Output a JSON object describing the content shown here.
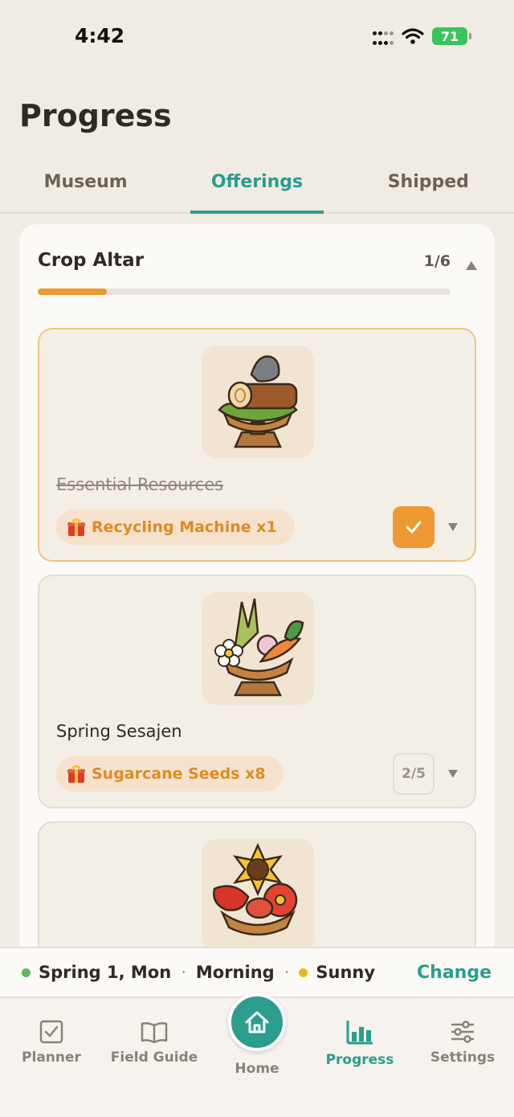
{
  "status": {
    "time": "4:42",
    "battery": "71"
  },
  "page": {
    "title": "Progress"
  },
  "tabs": [
    {
      "label": "Museum",
      "active": false
    },
    {
      "label": "Offerings",
      "active": true
    },
    {
      "label": "Shipped",
      "active": false
    }
  ],
  "altar": {
    "title": "Crop Altar",
    "count": "1/6",
    "progress": 0.167,
    "offerings": [
      {
        "title": "Essential Resources",
        "reward": "Recycling Machine x1",
        "completed": true
      },
      {
        "title": "Spring Sesajen",
        "reward": "Sugarcane Seeds x8",
        "completed": false,
        "count": "2/5"
      },
      {
        "title": "",
        "reward": "",
        "completed": false
      }
    ]
  },
  "date_bar": {
    "date": "Spring 1, Mon",
    "time_of_day": "Morning",
    "weather": "Sunny",
    "change_label": "Change"
  },
  "nav": [
    {
      "label": "Planner",
      "icon": "checkbox-icon"
    },
    {
      "label": "Field Guide",
      "icon": "book-icon"
    },
    {
      "label": "Home",
      "icon": "home-icon"
    },
    {
      "label": "Progress",
      "icon": "bar-chart-icon",
      "active": true
    },
    {
      "label": "Settings",
      "icon": "sliders-icon"
    }
  ],
  "colors": {
    "accent": "#2a9d8f",
    "orange": "#ed9830",
    "background": "#f1ece3"
  }
}
